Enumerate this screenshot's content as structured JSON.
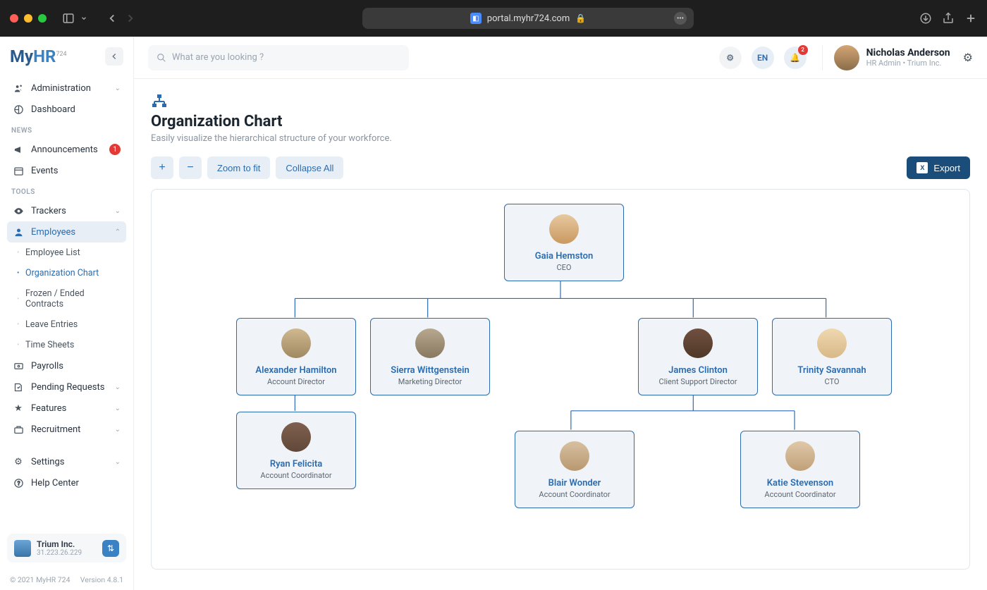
{
  "browser": {
    "url": "portal.myhr724.com"
  },
  "logo": {
    "my": "My",
    "hr": "HR",
    "sub": "724"
  },
  "sidebar": {
    "nav": {
      "administration": "Administration",
      "dashboard": "Dashboard"
    },
    "section_news": "NEWS",
    "news": {
      "announcements": "Announcements",
      "announcements_badge": "1",
      "events": "Events"
    },
    "section_tools": "TOOLS",
    "tools": {
      "trackers": "Trackers",
      "employees": "Employees",
      "payrolls": "Payrolls",
      "pending_requests": "Pending Requests",
      "features": "Features",
      "recruitment": "Recruitment"
    },
    "employees_sub": {
      "employee_list": "Employee List",
      "org_chart": "Organization Chart",
      "frozen": "Frozen / Ended Contracts",
      "leave": "Leave Entries",
      "timesheets": "Time Sheets"
    },
    "settings": "Settings",
    "help": "Help Center",
    "org": {
      "name": "Trium Inc.",
      "ip": "31.223.26.229"
    }
  },
  "footer": {
    "copyright": "© 2021 MyHR 724",
    "version": "Version 4.8.1"
  },
  "topbar": {
    "search_placeholder": "What are you looking ?",
    "lang": "EN",
    "notif_badge": "2",
    "user_name": "Nicholas Anderson",
    "user_role": "HR Admin • Trium Inc."
  },
  "page": {
    "title": "Organization Chart",
    "subtitle": "Easily visualize the hierarchical structure of your workforce.",
    "zoom_fit": "Zoom to fit",
    "collapse_all": "Collapse All",
    "export": "Export"
  },
  "chart": {
    "ceo": {
      "name": "Gaia Hemston",
      "title": "CEO"
    },
    "n1": {
      "name": "Alexander Hamilton",
      "title": "Account Director"
    },
    "n2": {
      "name": "Sierra Wittgenstein",
      "title": "Marketing Director"
    },
    "n3": {
      "name": "James Clinton",
      "title": "Client Support Director"
    },
    "n4": {
      "name": "Trinity Savannah",
      "title": "CTO"
    },
    "n5": {
      "name": "Ryan Felicita",
      "title": "Account Coordinator"
    },
    "n6": {
      "name": "Blair Wonder",
      "title": "Account Coordinator"
    },
    "n7": {
      "name": "Katie Stevenson",
      "title": "Account Coordinator"
    }
  }
}
